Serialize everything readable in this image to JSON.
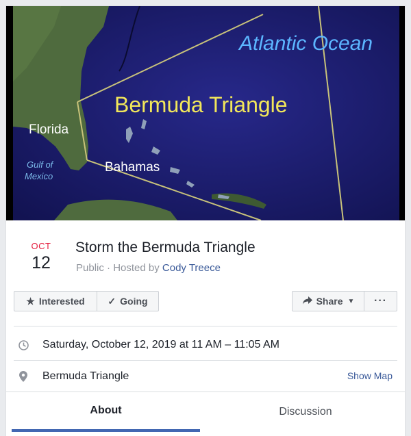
{
  "cover": {
    "labels": {
      "ocean": "Atlantic Ocean",
      "triangle": "Bermuda Triangle",
      "florida": "Florida",
      "gulf_line1": "Gulf of",
      "gulf_line2": "Mexico",
      "bahamas": "Bahamas"
    },
    "colors": {
      "sea": "#1b1c6a",
      "land": "#4f6b3e",
      "border": "#c8c27a",
      "ocean_label": "#5cb6ff"
    }
  },
  "event": {
    "month": "OCT",
    "day": "12",
    "title": "Storm the Bermuda Triangle",
    "visibility": "Public",
    "hosted_prefix": "· Hosted by",
    "host": "Cody Treece"
  },
  "actions": {
    "interested": "Interested",
    "going": "Going",
    "share": "Share",
    "more": "···"
  },
  "details": {
    "datetime": "Saturday, October 12, 2019 at 11 AM – 11:05 AM",
    "location": "Bermuda Triangle",
    "show_map": "Show Map"
  },
  "tabs": {
    "about": "About",
    "discussion": "Discussion"
  },
  "colors": {
    "accent": "#4267b2",
    "link": "#385898",
    "month": "#e41e3f"
  }
}
